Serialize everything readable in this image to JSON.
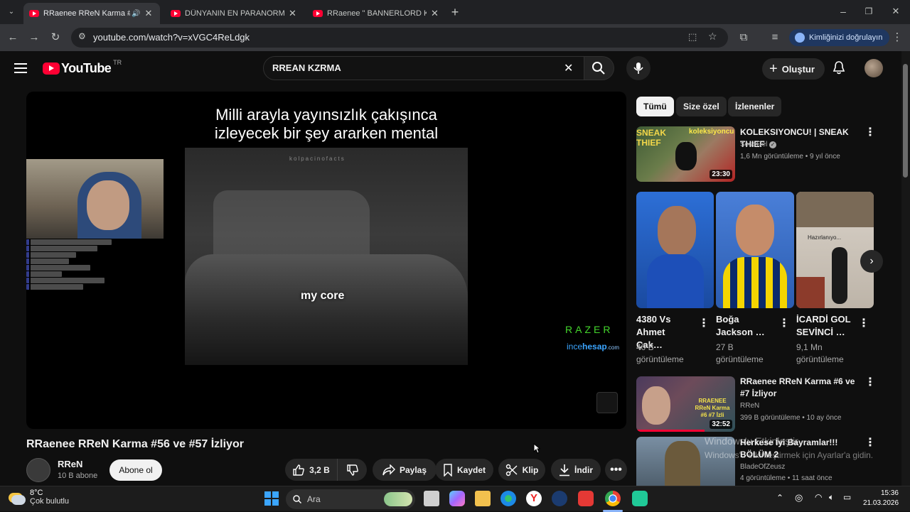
{
  "browser": {
    "tabs": [
      {
        "title": "RRaenee RReN Karma #56 ve #57 İzliyor",
        "active": true
      },
      {
        "title": "DÜNYANIN EN PARANORMAL OLAYLARI",
        "active": false
      },
      {
        "title": "RRaenee \" BANNERLORD KOMİK ANLAR",
        "active": false
      }
    ],
    "url": "youtube.com/watch?v=xVGC4ReLdgk",
    "profile_label": "Kimliğinizi doğrulayın"
  },
  "youtube": {
    "country_code": "TR",
    "logo_text": "YouTube",
    "search_value": "RREAN KZRMA",
    "create_label": "Oluştur",
    "video": {
      "title": "RRaenee RReN Karma #56 ve #57 İzliyor",
      "channel": "RReN",
      "subscribers": "10 B abone",
      "subscribe_label": "Abone ol",
      "likes": "3,2 B",
      "share_label": "Paylaş",
      "save_label": "Kaydet",
      "clip_label": "Klip",
      "download_label": "İndir",
      "overlay_line1": "Milli arayla yayınsızlık çakışınca",
      "overlay_line2": "izleyecek bir şey ararken mental",
      "caption": "my core",
      "watermark": "kolpacinofacts",
      "sponsor1": "RAZER",
      "sponsor2_a": "ince",
      "sponsor2_b": "hesap",
      "sponsor2_c": ".com"
    },
    "filter_chips": [
      "Tümü",
      "Size özel",
      "İzlenenler"
    ],
    "recommendations": [
      {
        "title": "KOLEKSIYONCU! | SNEAK THIEF",
        "channel": "SeseGel",
        "meta": "1,6 Mn görüntüleme • 9 yıl önce",
        "duration": "23:30",
        "thumb_text1": "SNEAK THIEF",
        "thumb_text2": "koleksiyoncu"
      },
      {
        "title": "RRaenee RReN Karma #6 ve #7 İzliyor",
        "channel": "RReN",
        "meta": "399 B görüntüleme • 10 ay önce",
        "duration": "32:52",
        "thumb_text": "RRAENEE RReN Karma #6 #7 İzli"
      },
      {
        "title": "Herkese İyi Bayramlar!!! BÖLÜM 2",
        "channel": "BladeOfZeusz",
        "meta": "4 görüntüleme • 11 saat önce",
        "duration": ""
      }
    ],
    "shorts": [
      {
        "title": "4380 Vs Ahmet Çak…",
        "views": "40 B",
        "views_unit": "görüntüleme"
      },
      {
        "title": "Boğa Jackson …",
        "views": "27 B",
        "views_unit": "görüntüleme"
      },
      {
        "title": "İCARDİ GOL SEVİNCİ …",
        "views": "9,1 Mn",
        "views_unit": "görüntüleme",
        "thumb_text": "Hazırlanıyo..."
      }
    ]
  },
  "activation": {
    "line1": "Windows'u Etkinleştir",
    "line2": "Windows'u etkinleştirmek için Ayarlar'a gidin."
  },
  "taskbar": {
    "temperature": "8°C",
    "weather": "Çok bulutlu",
    "search_placeholder": "Ara",
    "time": "15:36",
    "date": "21.03.2026"
  },
  "colors": {
    "brand": "#ff0033",
    "background": "#0f0f0f",
    "chip_bg": "#272727",
    "progress": "#ff0033"
  }
}
